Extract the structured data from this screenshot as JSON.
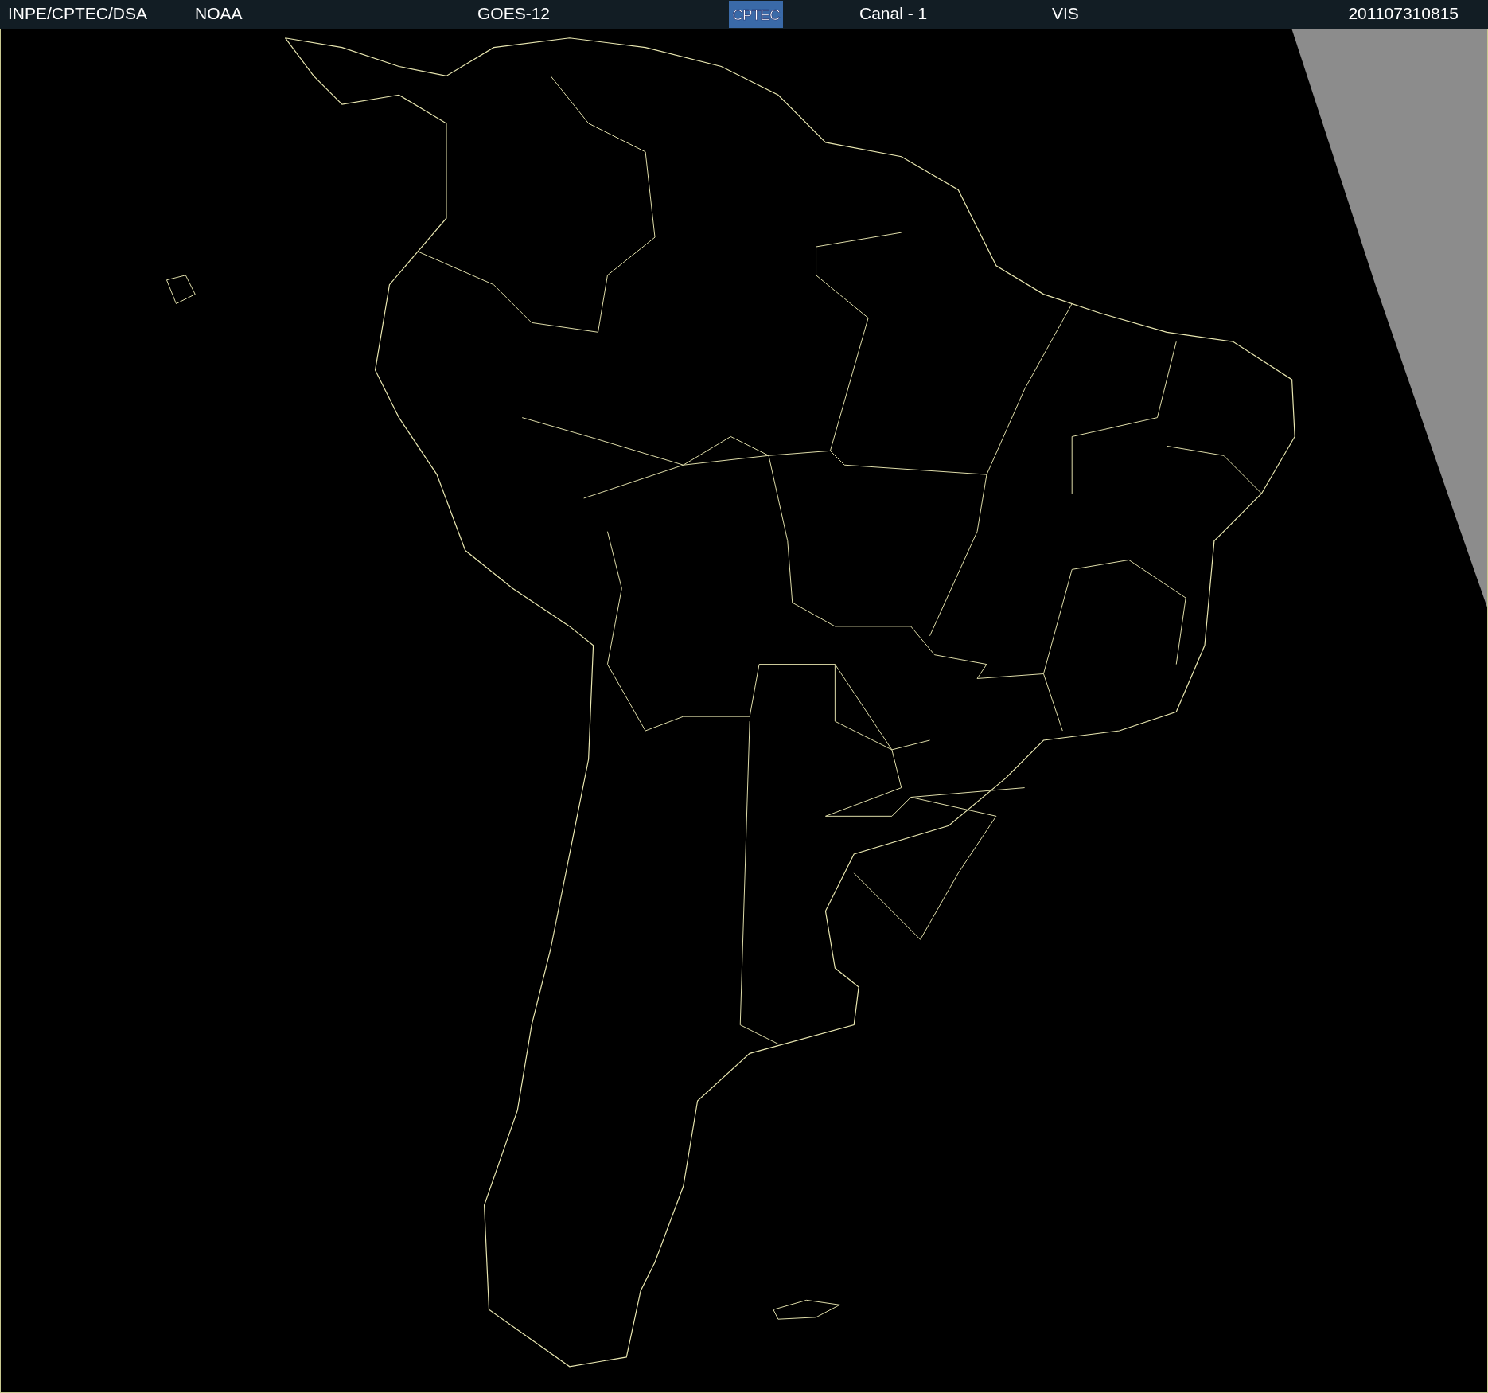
{
  "header": {
    "source": "INPE/CPTEC/DSA",
    "agency": "NOAA",
    "satellite": "GOES-12",
    "logo": "CPTEC",
    "channel": "Canal - 1",
    "band": "VIS",
    "timestamp": "201107310815"
  }
}
